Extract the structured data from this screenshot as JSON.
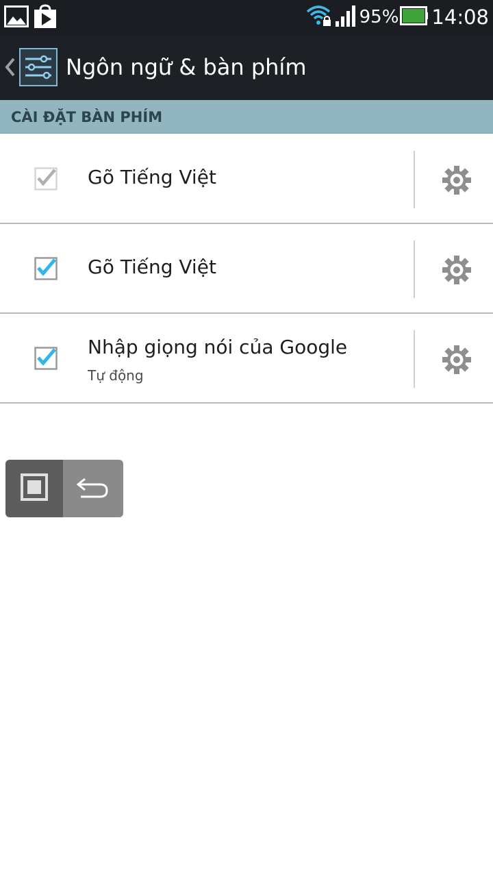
{
  "status_bar": {
    "battery_percent": "95%",
    "clock": "14:08",
    "icons": [
      "gallery-icon",
      "play-store-icon",
      "wifi-lock-icon",
      "signal-icon",
      "battery-icon"
    ],
    "colors": {
      "wifi": "#3fb8e8",
      "battery_fill": "#3fa33a"
    }
  },
  "action_bar": {
    "title": "Ngôn ngữ & bàn phím",
    "icon": "settings-sliders-icon"
  },
  "section": {
    "header": "CÀI ĐẶT BÀN PHÍM"
  },
  "items": [
    {
      "title": "Gõ Tiếng Việt",
      "summary": "",
      "checked": true,
      "enabled": false,
      "icon": "gear-icon"
    },
    {
      "title": "Gõ Tiếng Việt",
      "summary": "",
      "checked": true,
      "enabled": true,
      "icon": "gear-icon"
    },
    {
      "title": "Nhập giọng nói của Google",
      "summary": "Tự động",
      "checked": true,
      "enabled": true,
      "icon": "gear-icon"
    }
  ],
  "nav": {
    "home_icon": "square-home-icon",
    "back_icon": "back-arrow-icon"
  },
  "colors": {
    "accent": "#33b5e5",
    "section_header_bg": "#92b6c0",
    "action_bar_bg": "#1d2125"
  }
}
